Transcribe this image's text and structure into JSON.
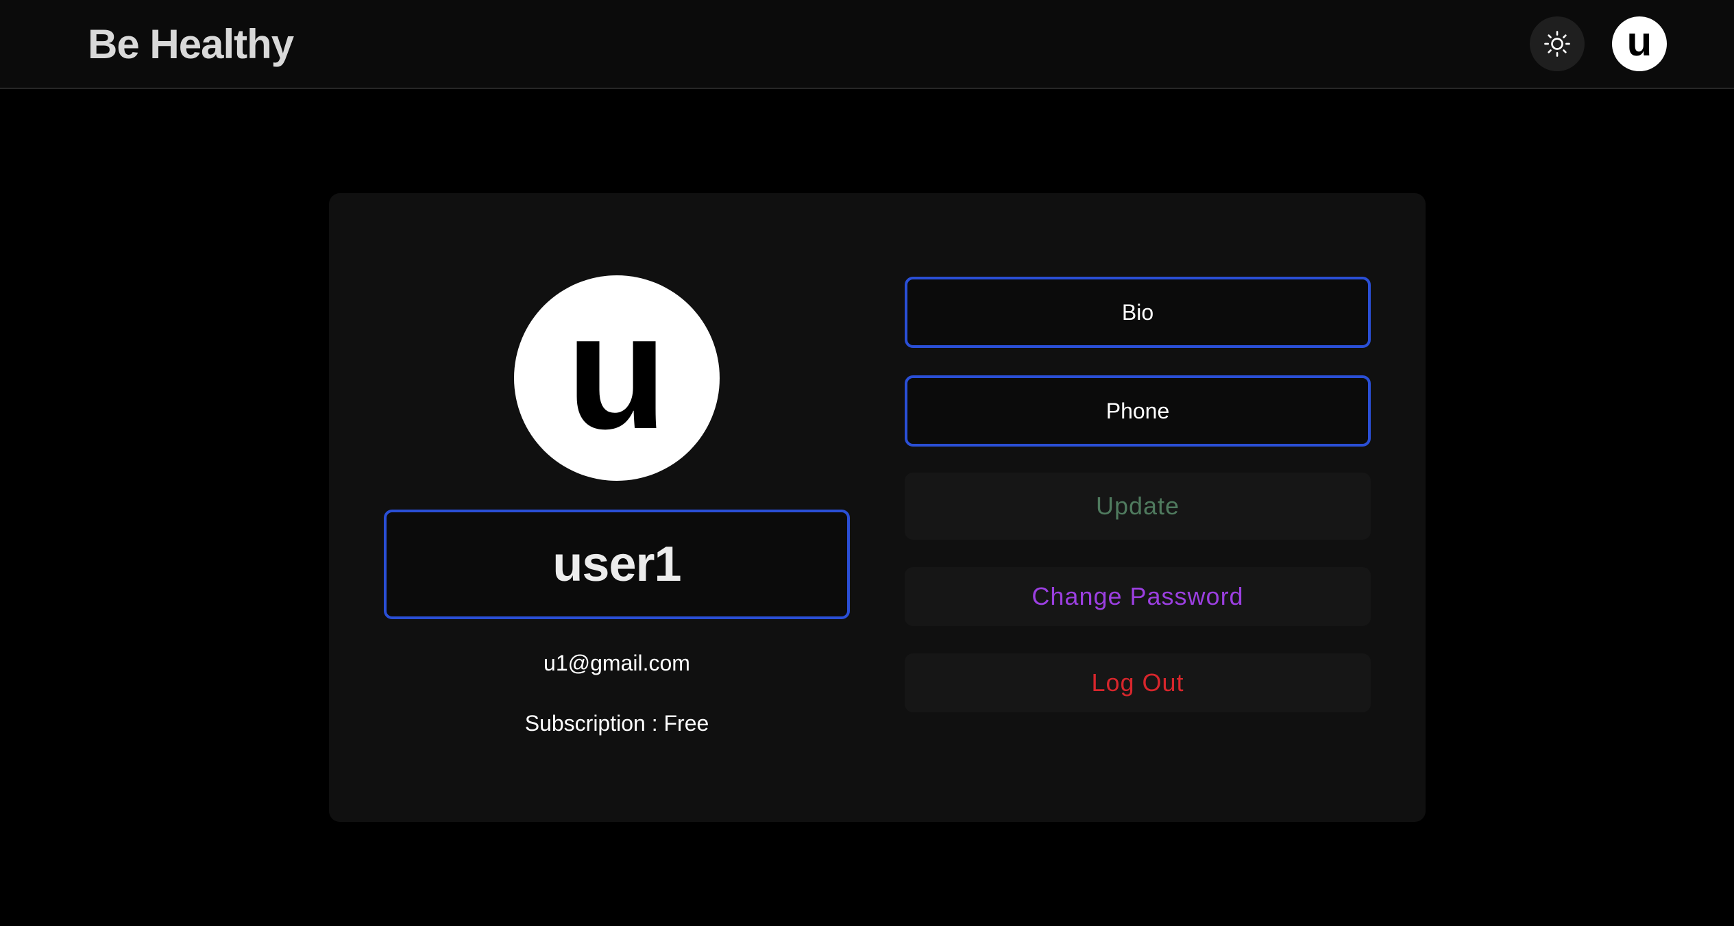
{
  "header": {
    "brand": "Be Healthy",
    "theme_icon": "sun-icon",
    "avatar_initial": "u"
  },
  "profile": {
    "avatar_initial": "u",
    "username": "user1",
    "email": "u1@gmail.com",
    "subscription": "Subscription : Free"
  },
  "fields": {
    "bio_label": "Bio",
    "phone_label": "Phone"
  },
  "actions": {
    "update_label": "Update",
    "change_password_label": "Change Password",
    "logout_label": "Log Out"
  },
  "colors": {
    "accent_border": "#2a4fd6",
    "update_text": "#4f7a5e",
    "change_password_text": "#9b3fe0",
    "logout_text": "#d7262c"
  }
}
